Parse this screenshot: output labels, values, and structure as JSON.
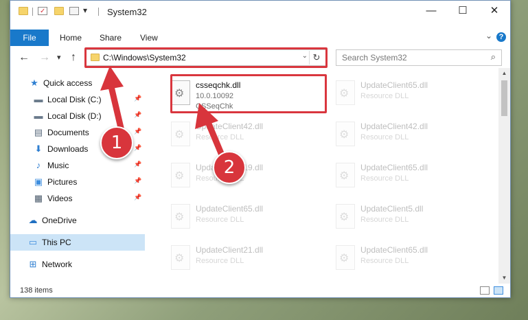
{
  "window": {
    "title": "System32",
    "controls": {
      "minimize": "—",
      "maximize": "☐",
      "close": "✕"
    }
  },
  "quick_toolbar": {
    "dropdown": "▾"
  },
  "ribbon": {
    "tabs": [
      "File",
      "Home",
      "Share",
      "View"
    ],
    "expand": "⌄",
    "help": "?"
  },
  "nav": {
    "back": "←",
    "forward": "→",
    "recent": "▾",
    "up": "↑",
    "address": "C:\\Windows\\System32",
    "address_dropdown": "⌄",
    "refresh": "↻",
    "search_placeholder": "Search System32",
    "search_icon": "⌕"
  },
  "sidebar": {
    "items": [
      {
        "label": "Quick access",
        "icon": "star-icon",
        "glyph": "★",
        "color": "#2f7fd1",
        "pinned": false
      },
      {
        "label": "Local Disk (C:)",
        "icon": "drive-icon",
        "glyph": "▬",
        "color": "#6b7b8c",
        "pinned": true
      },
      {
        "label": "Local Disk (D:)",
        "icon": "drive-icon",
        "glyph": "▬",
        "color": "#6b7b8c",
        "pinned": true
      },
      {
        "label": "Documents",
        "icon": "documents-icon",
        "glyph": "▤",
        "color": "#5a6b7d",
        "pinned": true
      },
      {
        "label": "Downloads",
        "icon": "downloads-icon",
        "glyph": "⬇",
        "color": "#2f7fd1",
        "pinned": true
      },
      {
        "label": "Music",
        "icon": "music-icon",
        "glyph": "♪",
        "color": "#2f7fd1",
        "pinned": true
      },
      {
        "label": "Pictures",
        "icon": "pictures-icon",
        "glyph": "▣",
        "color": "#3e8ede",
        "pinned": true
      },
      {
        "label": "Videos",
        "icon": "videos-icon",
        "glyph": "▦",
        "color": "#4a5a6a",
        "pinned": true
      },
      {
        "label": "OneDrive",
        "icon": "cloud-icon",
        "glyph": "☁",
        "color": "#1f6fc1",
        "pinned": false
      },
      {
        "label": "This PC",
        "icon": "computer-icon",
        "glyph": "▭",
        "color": "#3e8ede",
        "pinned": false
      },
      {
        "label": "Network",
        "icon": "network-icon",
        "glyph": "⊞",
        "color": "#2f7fd1",
        "pinned": false
      }
    ],
    "pin_glyph": "📌"
  },
  "files": [
    {
      "name": "csseqchk.dll",
      "line2": "10.0.10092",
      "line3": "CSSeqChk",
      "highlighted": true
    },
    {
      "name": "UpdateClient65.dll",
      "line2": "Resource DLL",
      "highlighted": false
    },
    {
      "name": "UpdateClient42.dll",
      "line2": "Resource DLL",
      "highlighted": false
    },
    {
      "name": "UpdateClient42.dll",
      "line2": "Resource DLL",
      "highlighted": false
    },
    {
      "name": "UpdateClient19.dll",
      "line2": "Resource DLL",
      "highlighted": false
    },
    {
      "name": "UpdateClient65.dll",
      "line2": "Resource DLL",
      "highlighted": false
    },
    {
      "name": "UpdateClient65.dll",
      "line2": "Resource DLL",
      "highlighted": false
    },
    {
      "name": "UpdateClient5.dll",
      "line2": "Resource DLL",
      "highlighted": false
    },
    {
      "name": "UpdateClient21.dll",
      "line2": "Resource DLL",
      "highlighted": false
    },
    {
      "name": "UpdateClient65.dll",
      "line2": "Resource DLL",
      "highlighted": false
    }
  ],
  "status": {
    "item_count": "138 items"
  },
  "scrollbar": {
    "up": "▲",
    "down": "▼"
  },
  "annotations": {
    "step1": "1",
    "step2": "2",
    "color": "#d8353c"
  }
}
